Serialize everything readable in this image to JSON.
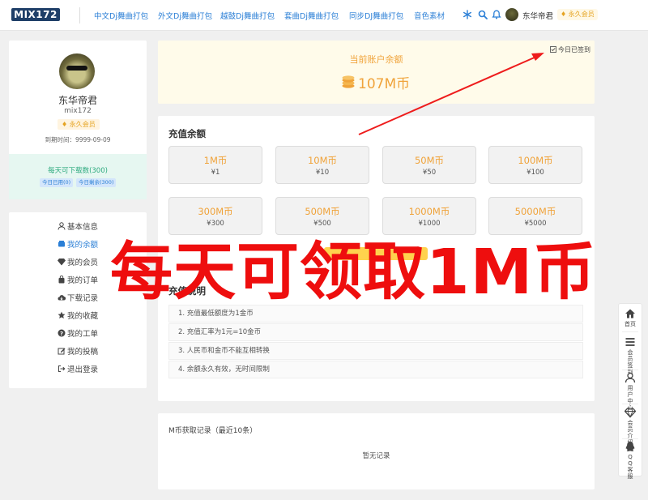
{
  "header": {
    "logo": "MIX172",
    "nav": [
      "中文Dj舞曲打包",
      "外文Dj舞曲打包",
      "越鼓Dj舞曲打包",
      "套曲Dj舞曲打包",
      "同步DJ舞曲打包",
      "音色素材"
    ],
    "username": "东华帝君",
    "vip_badge": "永久会员",
    "icons": [
      "snowflake-icon",
      "search-icon",
      "bell-icon"
    ]
  },
  "profile": {
    "name": "东华帝君",
    "user_id": "mix172",
    "vip_badge": "永久会员",
    "expire": "到期时间：9999-09-09",
    "daily_downloads": "每天可下载数(300)",
    "used_today": "今日已用(0)",
    "remaining_today": "今日剩余(300)"
  },
  "menu": {
    "items": [
      {
        "label": "基本信息",
        "icon": "user-icon"
      },
      {
        "label": "我的余额",
        "icon": "wallet-icon"
      },
      {
        "label": "我的会员",
        "icon": "diamond-icon"
      },
      {
        "label": "我的订单",
        "icon": "bag-icon"
      },
      {
        "label": "下载记录",
        "icon": "cloud-download-icon"
      },
      {
        "label": "我的收藏",
        "icon": "star-icon"
      },
      {
        "label": "我的工单",
        "icon": "question-icon"
      },
      {
        "label": "我的投稿",
        "icon": "edit-icon"
      },
      {
        "label": "退出登录",
        "icon": "logout-icon"
      }
    ],
    "active_index": 1
  },
  "balance": {
    "label": "当前账户余额",
    "value": "107M币",
    "signed_in": "今日已签到"
  },
  "recharge": {
    "title": "充值余额",
    "packages": [
      {
        "amount": "1M币",
        "price": "¥1"
      },
      {
        "amount": "10M币",
        "price": "¥10"
      },
      {
        "amount": "50M币",
        "price": "¥50"
      },
      {
        "amount": "100M币",
        "price": "¥100"
      },
      {
        "amount": "300M币",
        "price": "¥300"
      },
      {
        "amount": "500M币",
        "price": "¥500"
      },
      {
        "amount": "1000M币",
        "price": "¥1000"
      },
      {
        "amount": "5000M币",
        "price": "¥5000"
      }
    ],
    "notes_title": "充值说明",
    "notes": [
      "1. 充值最低额度为1金币",
      "2. 充值汇率为1元=10金币",
      "3. 人民币和金币不能互相转换",
      "4. 余额永久有效，无时间限制"
    ]
  },
  "records": {
    "title": "M币获取记录（最近10条）",
    "empty": "暂无记录"
  },
  "overlay": {
    "text": "每天可领取1M币",
    "color": "#ee0e0e"
  },
  "floatbar": {
    "items": [
      {
        "label": "首页",
        "icon": "home-icon"
      },
      {
        "label": "会员签到",
        "icon": "list-icon"
      },
      {
        "label": "用户中心",
        "icon": "user-icon"
      },
      {
        "label": "会员介绍",
        "icon": "diamond-icon"
      },
      {
        "label": "QQ客服",
        "icon": "qq-icon"
      }
    ]
  },
  "colors": {
    "accent_blue": "#2b7fd6",
    "gold": "#f0a33a",
    "green": "#2eaa7f"
  }
}
